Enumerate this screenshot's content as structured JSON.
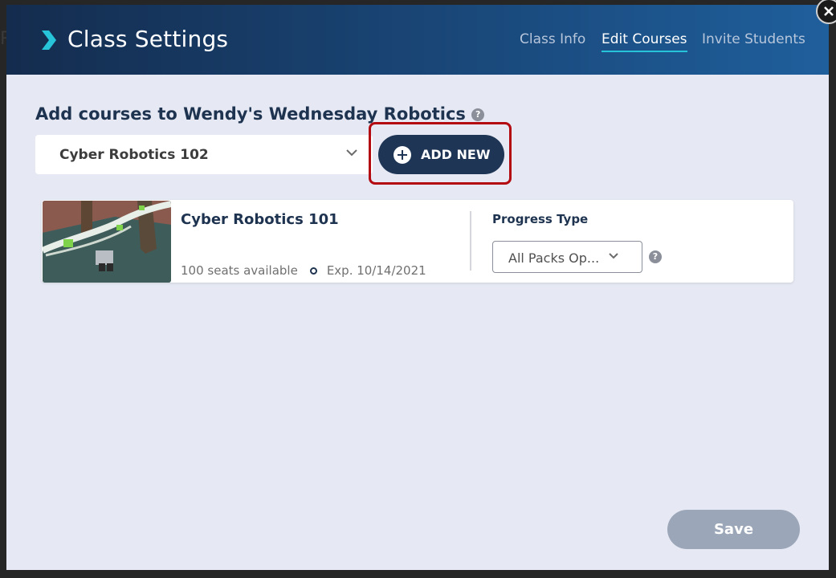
{
  "header": {
    "title": "Class Settings",
    "tabs": [
      {
        "label": "Class Info"
      },
      {
        "label": "Edit Courses"
      },
      {
        "label": "Invite Students"
      }
    ],
    "close_glyph": "×"
  },
  "main": {
    "heading": "Add courses to Wendy's Wednesday Robotics",
    "help_glyph": "?",
    "course_select": {
      "value": "Cyber Robotics 102"
    },
    "add_new_label": "ADD NEW"
  },
  "course_card": {
    "title": "Cyber Robotics 101",
    "seats": "100 seats available",
    "expiry": "Exp. 10/14/2021",
    "progress_type_label": "Progress Type",
    "progress_type_value": "All Packs Op..."
  },
  "footer": {
    "save_label": "Save"
  },
  "colors": {
    "accent": "#27c3d8",
    "primary": "#1e3556",
    "highlight": "#b40a12",
    "save_disabled": "#9ba6b8"
  },
  "icons": [
    "chevron-right-icon",
    "close-icon",
    "help-icon",
    "chevron-down-icon",
    "plus-circle-icon"
  ]
}
